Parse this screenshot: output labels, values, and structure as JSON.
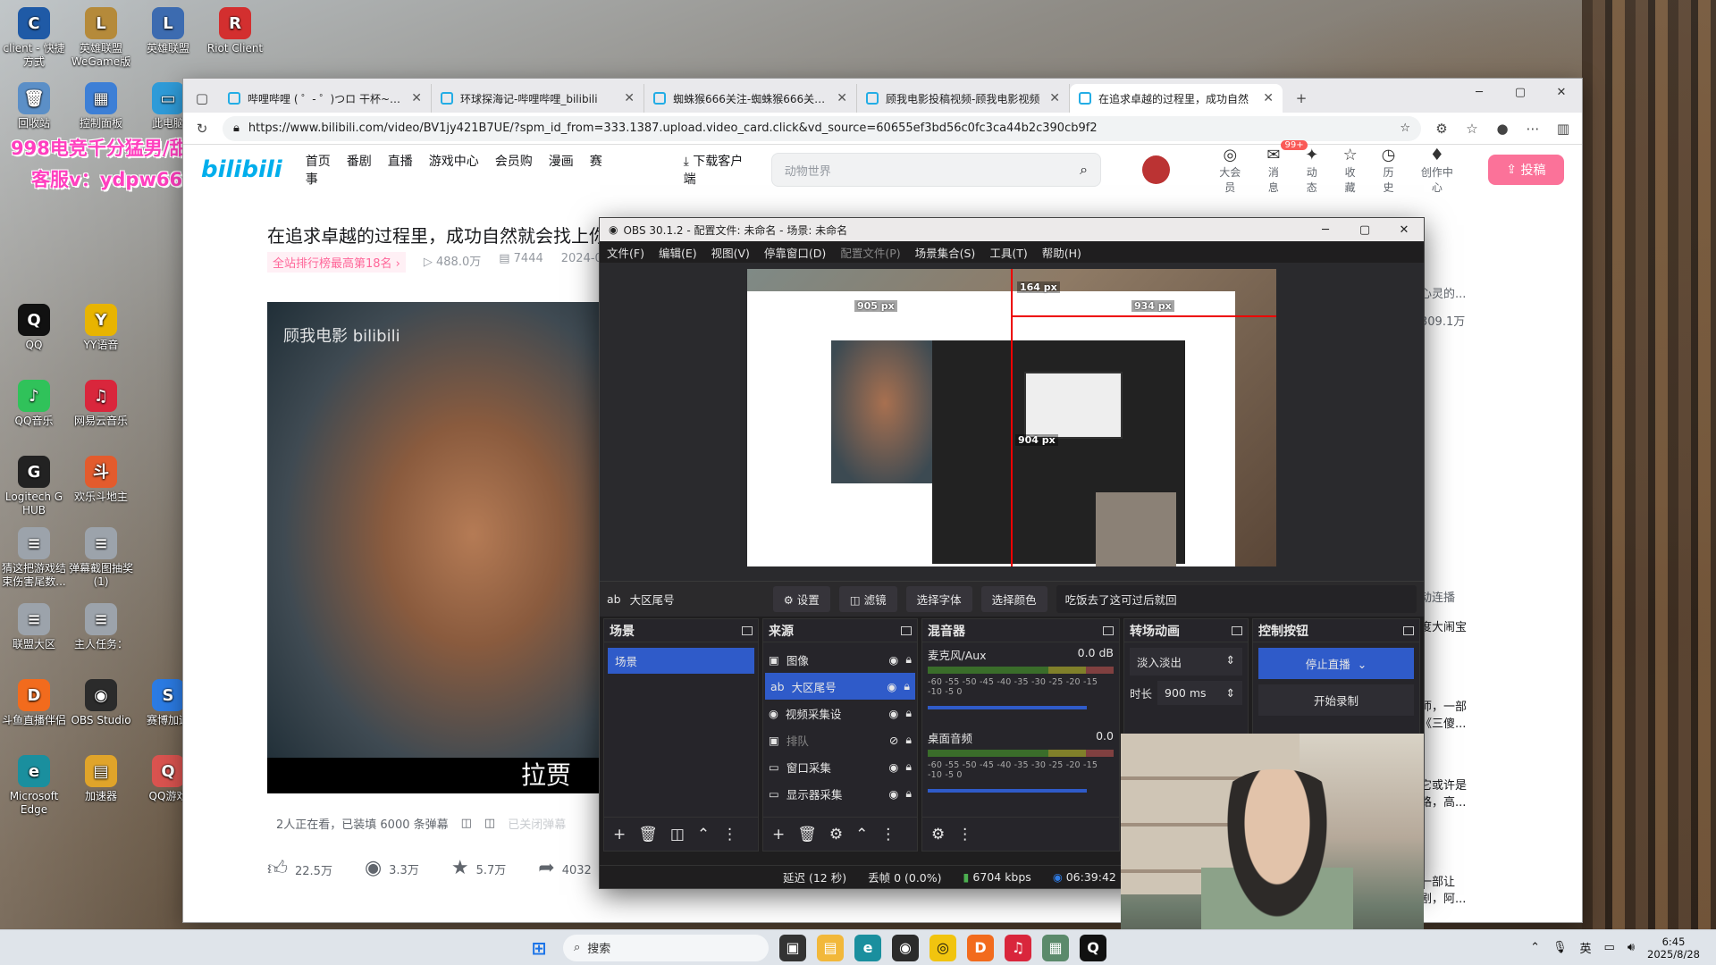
{
  "desktop": {
    "icons": [
      {
        "label": "client - 快捷方式",
        "glyph": "C",
        "color": "#1f5aa6"
      },
      {
        "label": "英雄联盟WeGame版",
        "glyph": "L",
        "color": "#b58a3a"
      },
      {
        "label": "英雄联盟",
        "glyph": "L",
        "color": "#3c6bb0"
      },
      {
        "label": "Riot Client",
        "glyph": "R",
        "color": "#d32f2f"
      },
      {
        "label": "回收站",
        "glyph": "🗑",
        "color": "#5b8fc7"
      },
      {
        "label": "控制面板",
        "glyph": "▦",
        "color": "#3d7fd6"
      },
      {
        "label": "此电脑",
        "glyph": "▭",
        "color": "#2f9bd8"
      },
      {
        "label": "QQ",
        "glyph": "Q",
        "color": "#111"
      },
      {
        "label": "YY语音",
        "glyph": "Y",
        "color": "#e8b400"
      },
      {
        "label": "QQ音乐",
        "glyph": "♪",
        "color": "#30c25a"
      },
      {
        "label": "网易云音乐",
        "glyph": "♫",
        "color": "#d9263c"
      },
      {
        "label": "Logitech G HUB",
        "glyph": "G",
        "color": "#222"
      },
      {
        "label": "欢乐斗地主",
        "glyph": "斗",
        "color": "#e35b2d"
      },
      {
        "label": "猜这把游戏结束伤害尾数...",
        "glyph": "≡",
        "color": "#9ca3ab"
      },
      {
        "label": "弹幕截图抽奖(1)",
        "glyph": "≡",
        "color": "#9ca3ab"
      },
      {
        "label": "联盟大区",
        "glyph": "≡",
        "color": "#9ca3ab"
      },
      {
        "label": "主人任务：",
        "glyph": "≡",
        "color": "#9ca3ab"
      },
      {
        "label": "斗鱼直播伴侣",
        "glyph": "D",
        "color": "#f26b1d"
      },
      {
        "label": "OBS Studio",
        "glyph": "◉",
        "color": "#2b2b2b"
      },
      {
        "label": "赛博加速",
        "glyph": "S",
        "color": "#2b7be3"
      },
      {
        "label": "Microsoft Edge",
        "glyph": "e",
        "color": "#1a8f9e"
      },
      {
        "label": "加速器",
        "glyph": "▤",
        "color": "#e0a42a"
      },
      {
        "label": "QQ游戏",
        "glyph": "Q",
        "color": "#d9534f"
      }
    ],
    "overlay_line1": "998电竞千分猛男/甜妹",
    "overlay_line2": "客服v：ydpw666"
  },
  "browser": {
    "tabs": [
      {
        "title": "哔哩哔哩 ( ゜- ゜)つロ 干杯~-bilibi",
        "active": false
      },
      {
        "title": "环球探海记-哔哩哔哩_bilibili",
        "active": false
      },
      {
        "title": "蜘蛛猴666关注-蜘蛛猴666关注U",
        "active": false
      },
      {
        "title": "顾我电影投稿视频-顾我电影视频",
        "active": false
      },
      {
        "title": "在追求卓越的过程里，成功自然",
        "active": true
      }
    ],
    "url": "https://www.bilibili.com/video/BV1jy421B7UE/?spm_id_from=333.1387.upload.video_card.click&vd_source=60655ef3bd56c0fc3ca44b2c390cb9f2"
  },
  "bili": {
    "logo": "bilibili",
    "nav": [
      "首页",
      "番剧",
      "直播",
      "游戏中心",
      "会员购",
      "漫画",
      "赛事"
    ],
    "download_label": "下载客户端",
    "search_placeholder": "动物世界",
    "header_icons": [
      {
        "label": "大会员",
        "glyph": "◎"
      },
      {
        "label": "消息",
        "glyph": "✉"
      },
      {
        "label": "动态",
        "glyph": "✦"
      },
      {
        "label": "收藏",
        "glyph": "☆"
      },
      {
        "label": "历史",
        "glyph": "◷"
      },
      {
        "label": "创作中心",
        "glyph": "♦"
      }
    ],
    "message_badge": "99+",
    "upload_label": "投稿",
    "video_title": "在追求卓越的过程里，成功自然就会找上你",
    "rank_text": "全站排行榜最高第18名 ›",
    "views": "488.0万",
    "danmaku_count": "7444",
    "date": "2024-0",
    "watermark": "顾我电影 bilibili",
    "subtitle": "拉贾",
    "watching": "2人正在看，已装填 6000 条弹幕",
    "danmu_closed": "已关闭弹幕",
    "likes": "22.5万",
    "coins": "3.3万",
    "favs": "5.7万",
    "shares": "4032",
    "right_side": {
      "line1": "心灵的...",
      "line2": "309.1万",
      "line3": "动连播",
      "line4": "度大闹宝",
      "line5": "师，一部",
      "line6": "《三傻...",
      "line7": "它或许是",
      "line8": "路，高...",
      "line9": "一部让",
      "line10": "剧，阿..."
    }
  },
  "obs": {
    "title": "OBS 30.1.2 - 配置文件: 未命名 - 场景: 未命名",
    "menu": [
      "文件(F)",
      "编辑(E)",
      "视图(V)",
      "停靠窗口(D)",
      "配置文件(P)",
      "场景集合(S)",
      "工具(T)",
      "帮助(H)"
    ],
    "guide_labels": {
      "top": "164 px",
      "left": "905 px",
      "right": "934 px",
      "bottom": "904 px"
    },
    "selected_source": "大区尾号",
    "btn_settings": "设置",
    "btn_filters": "滤镜",
    "btn_font": "选择字体",
    "btn_color": "选择颜色",
    "text_value": "吃饭去了这可过后就回",
    "docks": {
      "scenes": "场景",
      "sources": "来源",
      "mixer": "混音器",
      "transitions": "转场动画",
      "controls": "控制按钮"
    },
    "scene_list": [
      "场景"
    ],
    "sources": [
      {
        "name": "图像",
        "icon": "▣",
        "visible": true
      },
      {
        "name": "大区尾号",
        "icon": "ab",
        "visible": true
      },
      {
        "name": "视频采集设",
        "icon": "◉",
        "visible": true
      },
      {
        "name": "排队",
        "icon": "▣",
        "visible": false
      },
      {
        "name": "窗口采集",
        "icon": "▭",
        "visible": true
      },
      {
        "name": "显示器采集",
        "icon": "▭",
        "visible": true
      }
    ],
    "mixer": [
      {
        "name": "麦克风/Aux",
        "db": "0.0 dB"
      },
      {
        "name": "桌面音频",
        "db": "0.0"
      }
    ],
    "meter_scale": "-60 -55 -50 -45 -40 -35 -30 -25 -20 -15 -10 -5 0",
    "transition": "淡入淡出",
    "duration_label": "时长",
    "duration_value": "900 ms",
    "stop_stream": "停止直播",
    "start_record": "开始录制",
    "status": {
      "delay": "延迟 (12 秒)",
      "dropped": "丢帧 0 (0.0%)",
      "bitrate": "6704 kbps",
      "time": "06:39:42"
    }
  },
  "taskbar": {
    "search": "搜索",
    "ime": "英",
    "time": "6:45",
    "date": "2025/8/28"
  }
}
